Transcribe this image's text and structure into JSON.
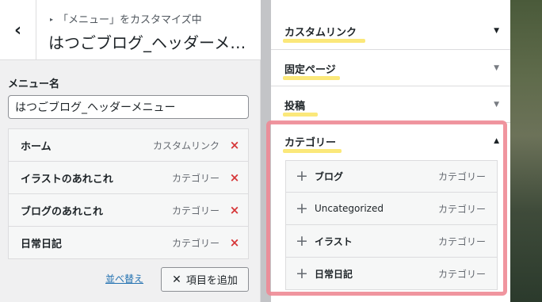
{
  "header": {
    "back_icon": "‹",
    "breadcrumb": "「メニュー」をカスタマイズ中",
    "title": "はつごブログ_ヘッダーメニュー"
  },
  "menu_name": {
    "label": "メニュー名",
    "value": "はつごブログ_ヘッダーメニュー"
  },
  "menu_items": [
    {
      "title": "ホーム",
      "type": "カスタムリンク"
    },
    {
      "title": "イラストのあれこれ",
      "type": "カテゴリー"
    },
    {
      "title": "ブログのあれこれ",
      "type": "カテゴリー"
    },
    {
      "title": "日常日記",
      "type": "カテゴリー"
    }
  ],
  "remove_icon": "×",
  "footer": {
    "reorder_label": "並べ替え",
    "add_icon": "✕",
    "add_items_label": "項目を追加"
  },
  "sections": [
    {
      "title": "カスタムリンク",
      "arrow": "▼"
    },
    {
      "title": "固定ページ",
      "arrow": "▼"
    },
    {
      "title": "投稿",
      "arrow": "▼"
    },
    {
      "title": "カテゴリー",
      "arrow": "▲"
    }
  ],
  "category_items": [
    {
      "title": "ブログ",
      "type": "カテゴリー"
    },
    {
      "title": "Uncategorized",
      "type": "カテゴリー"
    },
    {
      "title": "イラスト",
      "type": "カテゴリー"
    },
    {
      "title": "日常日記",
      "type": "カテゴリー"
    }
  ],
  "plus_icon": "+",
  "colors": {
    "highlight": "#fbe56b",
    "annotation_box": "#ee8995",
    "remove": "#d63638",
    "link": "#2271b1"
  }
}
